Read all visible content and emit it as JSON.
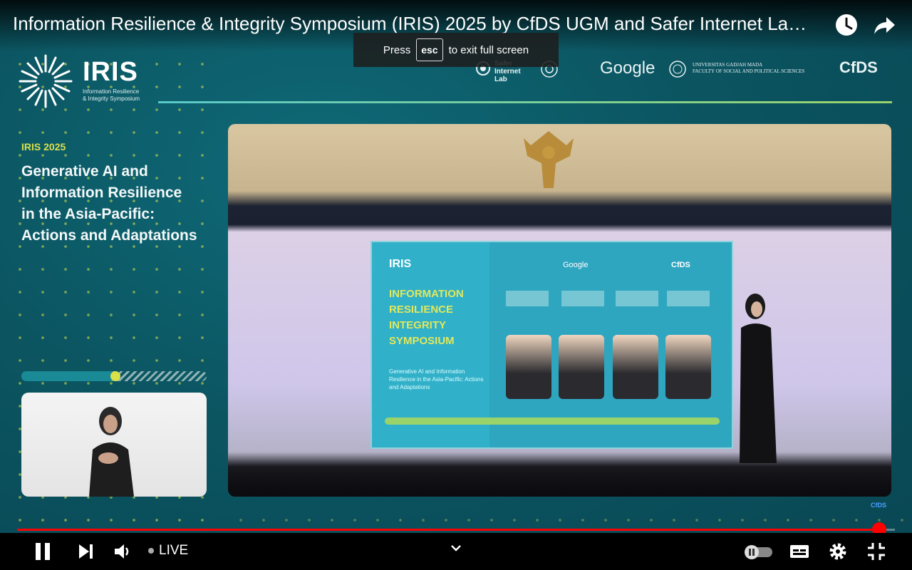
{
  "window": {
    "video_title": "Information Resilience & Integrity Symposium (IRIS) 2025 by CfDS UGM and Safer Internet La…"
  },
  "toast": {
    "prefix": "Press",
    "key": "esc",
    "suffix": "to exit full screen"
  },
  "brand": {
    "logo_word": "IRIS",
    "logo_sub_line1": "Information Resilience",
    "logo_sub_line2": "& Integrity Symposium"
  },
  "sponsors": {
    "safer": "Safer Internet Lab",
    "google": "Google",
    "ugm_line1": "UNIVERSITAS GADJAH MADA",
    "ugm_line2": "FACULTY OF SOCIAL AND POLITICAL SCIENCES",
    "cfds": "CfDS"
  },
  "sidebar": {
    "tag": "IRIS 2025",
    "headline_lines": [
      "Generative AI and",
      "Information Resilience",
      "in the Asia-Pacific:",
      "Actions and Adaptations"
    ]
  },
  "stage_screen": {
    "logo": "IRIS",
    "google": "Google",
    "cfds": "CfDS",
    "title_lines": [
      "INFORMATION",
      "RESILIENCE",
      "INTEGRITY",
      "SYMPOSIUM"
    ],
    "subtitle": "Generative AI and Information Resilience in the Asia-Pacific: Actions and Adaptations"
  },
  "player": {
    "live_label": "LIVE",
    "progress": 0.982,
    "watermark": "CfDS"
  },
  "colors": {
    "background": "#0b5561",
    "accent_yellow": "#d8e04a",
    "progress": "#ff0000"
  }
}
